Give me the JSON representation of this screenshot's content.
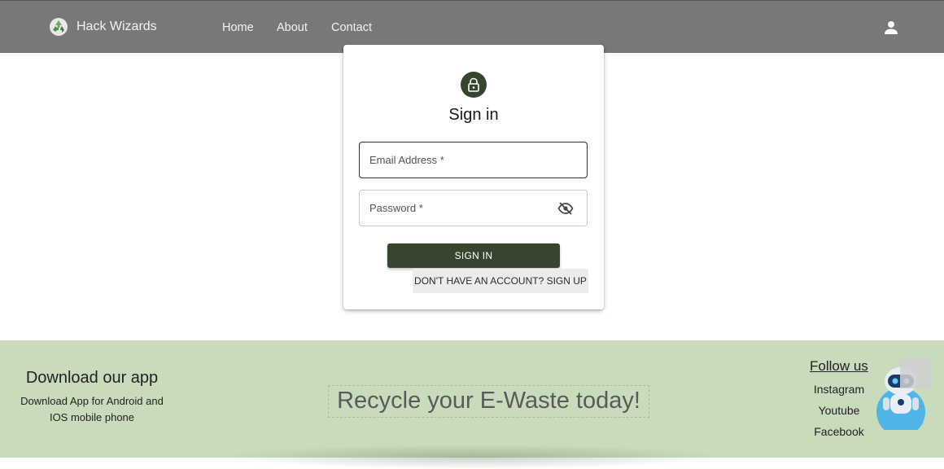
{
  "header": {
    "brand": "Hack Wizards",
    "nav": [
      "Home",
      "About",
      "Contact"
    ]
  },
  "signin": {
    "title": "Sign in",
    "email_placeholder": "Email Address *",
    "password_placeholder": "Password *",
    "button": "SIGN IN",
    "signup_link": "DON'T HAVE AN ACCOUNT? SIGN UP"
  },
  "footer": {
    "download_title": "Download our app",
    "download_desc": "Download App for Android and IOS mobile phone",
    "tagline": "Recycle your E-Waste today!",
    "follow_title": "Follow us",
    "social": [
      "Instagram",
      "Youtube",
      "Facebook"
    ]
  },
  "colors": {
    "navbar": "#787878",
    "primary": "#37452f",
    "footer": "#c8dbbc"
  },
  "icons": {
    "brand": "recycle-icon",
    "account": "person-icon",
    "lock": "lock-icon",
    "visibility": "visibility-off-icon",
    "assistant": "robot-icon"
  }
}
